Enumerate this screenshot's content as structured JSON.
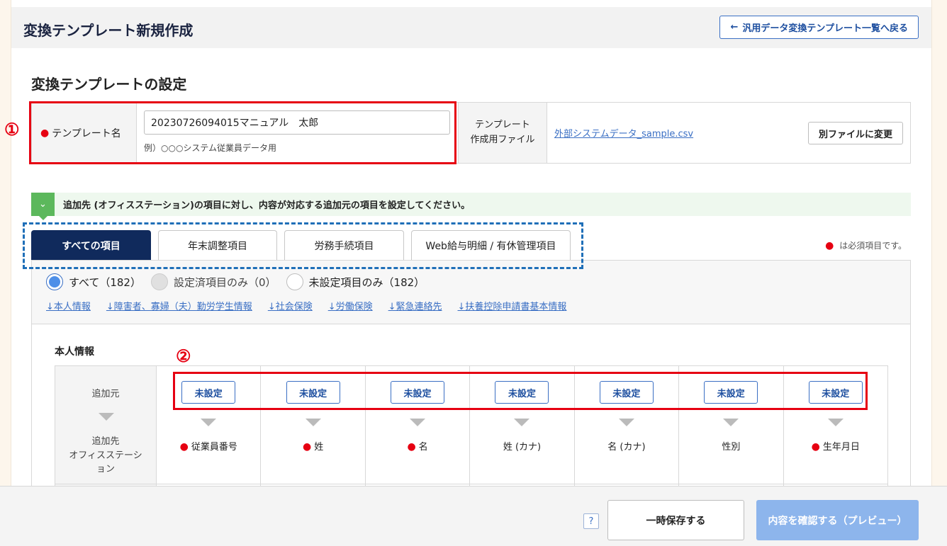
{
  "header": {
    "title": "変換テンプレート新規作成",
    "back_button": "汎用データ変換テンプレート一覧へ戻る"
  },
  "settings": {
    "title": "変換テンプレートの設定",
    "template_name_label": "テンプレート名",
    "template_name_value": "20230726094015マニュアル　太郎",
    "template_name_hint": "例）○○○システム従業員データ用",
    "file_label_line1": "テンプレート",
    "file_label_line2": "作成用ファイル",
    "file_name": "外部システムデータ_sample.csv",
    "change_file_button": "別ファイルに変更"
  },
  "markers": {
    "one": "①",
    "two": "②"
  },
  "notice": "追加先 (オフィスステーション)の項目に対し、内容が対応する追加元の項目を設定してください。",
  "tabs": [
    "すべての項目",
    "年末調整項目",
    "労務手続項目",
    "Web給与明細 / 有休管理項目"
  ],
  "required_note": "は必須項目です。",
  "filters": {
    "all": "すべて（182）",
    "set_only": "設定済項目のみ（0）",
    "unset_only": "未設定項目のみ（182）"
  },
  "anchors": [
    "↓本人情報",
    "↓障害者、寡婦（夫）勤労学生情報",
    "↓社会保険",
    "↓労働保険",
    "↓緊急連絡先",
    "↓扶養控除申請書基本情報"
  ],
  "mapping": {
    "section_title": "本人情報",
    "source_label": "追加元",
    "dest_label_line1": "追加先",
    "dest_label_line2": "オフィスステーシ",
    "dest_label_line3": "ョン",
    "unset_label": "未設定",
    "columns": [
      {
        "name": "従業員番号",
        "required": true
      },
      {
        "name": "姓",
        "required": true
      },
      {
        "name": "名",
        "required": true
      },
      {
        "name": "姓 (カナ)",
        "required": false
      },
      {
        "name": "名 (カナ)",
        "required": false
      },
      {
        "name": "性別",
        "required": false
      },
      {
        "name": "生年月日",
        "required": true
      }
    ]
  },
  "footer": {
    "help": "?",
    "save_button": "一時保存する",
    "preview_button": "内容を確認する（プレビュー）"
  },
  "colors": {
    "accent": "#102a5c",
    "link": "#3a6fc4",
    "required": "#e60012",
    "annotation_red": "#e60012",
    "annotation_blue": "#1f6fb8"
  },
  "icons": {
    "back": "arrow-left-icon",
    "notice": "chevron-down-icon",
    "help": "question-icon"
  }
}
